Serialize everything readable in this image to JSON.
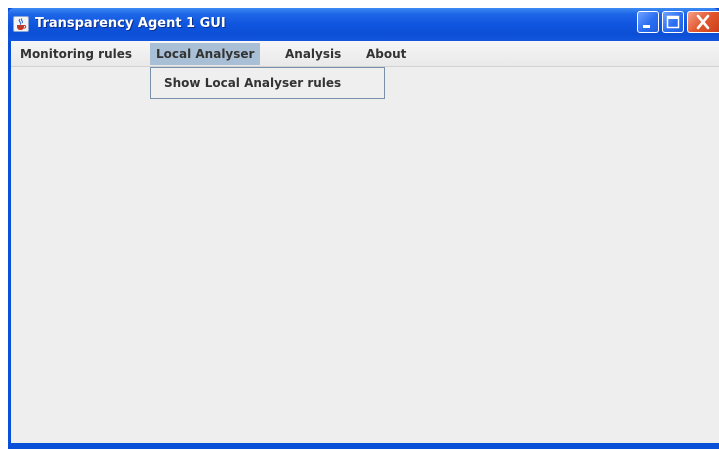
{
  "window": {
    "title": "Transparency Agent 1 GUI",
    "app_icon": "java-cup-icon",
    "controls": {
      "minimize": "minimize-icon",
      "maximize": "maximize-icon",
      "close": "close-icon"
    }
  },
  "menubar": {
    "items": [
      {
        "label": "Monitoring rules",
        "selected": false
      },
      {
        "label": "Local Analyser",
        "selected": true
      },
      {
        "label": "Analysis",
        "selected": false
      },
      {
        "label": "About",
        "selected": false
      }
    ]
  },
  "dropdown": {
    "items": [
      {
        "label": "Show Local Analyser rules"
      }
    ]
  },
  "colors": {
    "titlebar": "#0c4fd6",
    "menu_selected": "#a9bfd6",
    "client_background": "#eeeeee",
    "close_button": "#e3572d"
  }
}
